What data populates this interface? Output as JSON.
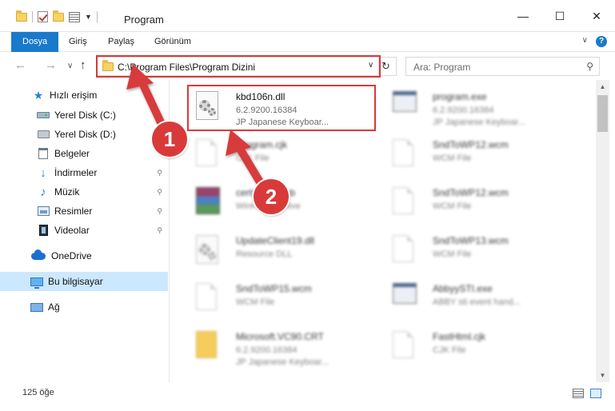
{
  "window": {
    "title": "Program",
    "minimize": "—",
    "maximize": "☐",
    "close": "✕"
  },
  "ribbon": {
    "tabs": [
      "Dosya",
      "Giriş",
      "Paylaş",
      "Görünüm"
    ],
    "help": "?",
    "collapse": "∨"
  },
  "nav": {
    "back": "←",
    "forward": "→",
    "recent": "∨",
    "up": "↑",
    "address": "C:\\Program Files\\Program Dizini",
    "address_drop": "∨",
    "refresh": "↻",
    "search_placeholder": "Ara: Program",
    "search_icon": "⚲"
  },
  "sidebar": {
    "items": [
      {
        "label": "Hızlı erişim",
        "icon": "star-icon"
      },
      {
        "label": "Yerel Disk (C:)",
        "icon": "drive-icon"
      },
      {
        "label": "Yerel Disk (D:)",
        "icon": "drive-icon"
      },
      {
        "label": "Belgeler",
        "icon": "documents-icon"
      },
      {
        "label": "İndirmeler",
        "icon": "downloads-icon"
      },
      {
        "label": "Müzik",
        "icon": "music-icon"
      },
      {
        "label": "Resimler",
        "icon": "pictures-icon"
      },
      {
        "label": "Videolar",
        "icon": "videos-icon"
      },
      {
        "label": "OneDrive",
        "icon": "onedrive-icon"
      },
      {
        "label": "Bu bilgisayar",
        "icon": "this-pc-icon"
      },
      {
        "label": "Ağ",
        "icon": "network-icon"
      }
    ],
    "pin": "📌"
  },
  "files": {
    "left": [
      {
        "name": "kbd106n.dll",
        "line1": "6.2.9200.16384",
        "line2": "JP Japanese Keyboar..."
      },
      {
        "name": "Program.cjk",
        "line1": "CJK File",
        "line2": ""
      },
      {
        "name": "certificate.cab",
        "line1": "WinRAR archive",
        "line2": ""
      },
      {
        "name": "UpdateClient19.dll",
        "line1": "Resource DLL",
        "line2": ""
      },
      {
        "name": "SndToWP15.wcm",
        "line1": "WCM File",
        "line2": ""
      },
      {
        "name": "Microsoft.VC90.CRT",
        "line1": "6.2.9200.16384",
        "line2": "JP Japanese Keyboar..."
      }
    ],
    "right": [
      {
        "name": "program.exe",
        "line1": "6.2.9200.16384",
        "line2": "JP Japanese Keyboar..."
      },
      {
        "name": "SndToWP12.wcm",
        "line1": "WCM File",
        "line2": ""
      },
      {
        "name": "SndToWP12.wcm",
        "line1": "WCM File",
        "line2": ""
      },
      {
        "name": "SndToWP13.wcm",
        "line1": "WCM File",
        "line2": ""
      },
      {
        "name": "AbbyySTI.exe",
        "line1": "ABBY sti event hand...",
        "line2": ""
      },
      {
        "name": "FastHtml.cjk",
        "line1": "CJK File",
        "line2": ""
      }
    ]
  },
  "annotations": {
    "badge1": "1",
    "badge2": "2",
    "highlight_color": "#d83a3a"
  },
  "status": {
    "count": "125 öğe"
  },
  "colors": {
    "accent": "#1979ca",
    "selected": "#cce8ff",
    "annotation": "#d83a3a"
  }
}
